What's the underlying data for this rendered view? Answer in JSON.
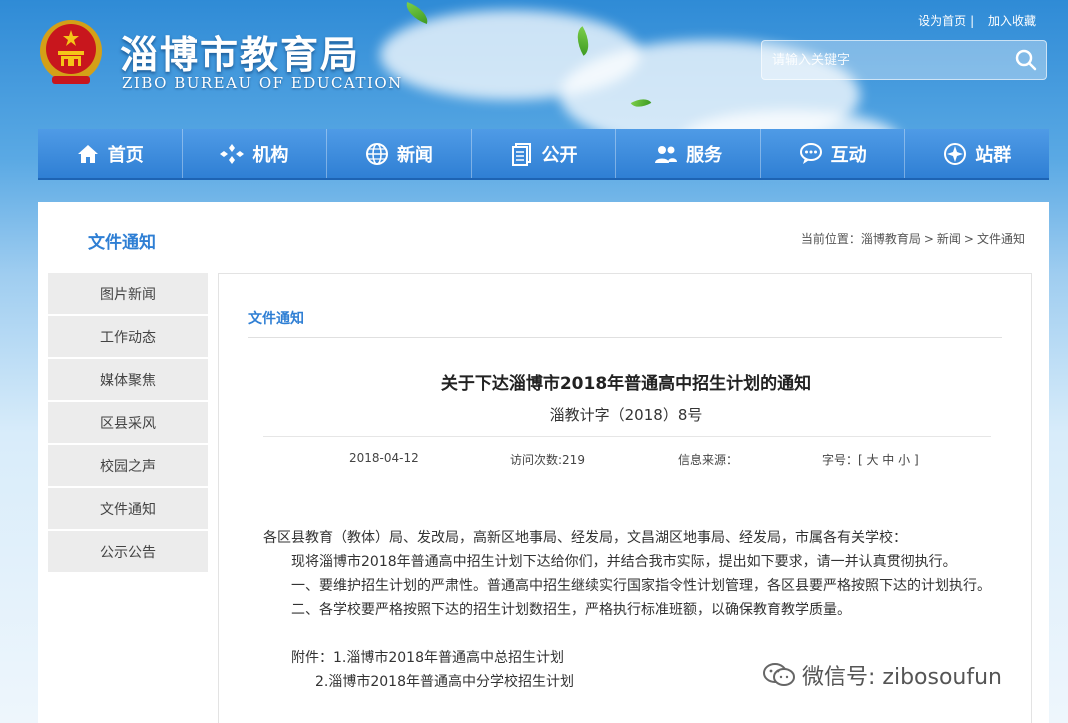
{
  "header": {
    "title": "淄博市教育局",
    "subtitle": "ZIBO BUREAU OF EDUCATION",
    "top_links": [
      "设为首页",
      "加入收藏"
    ],
    "top_sep": "|",
    "search_placeholder": "请输入关键字"
  },
  "nav": [
    {
      "label": "首页",
      "icon": "home-icon"
    },
    {
      "label": "机构",
      "icon": "org-icon"
    },
    {
      "label": "新闻",
      "icon": "globe-icon"
    },
    {
      "label": "公开",
      "icon": "document-icon"
    },
    {
      "label": "服务",
      "icon": "people-icon"
    },
    {
      "label": "互动",
      "icon": "chat-icon"
    },
    {
      "label": "站群",
      "icon": "sitegroup-icon"
    }
  ],
  "sidebar": {
    "title": "文件通知",
    "items": [
      "图片新闻",
      "工作动态",
      "媒体聚焦",
      "区县采风",
      "校园之声",
      "文件通知",
      "公示公告"
    ]
  },
  "breadcrumb": {
    "prefix": "当前位置：",
    "items": [
      "淄博教育局",
      "新闻",
      "文件通知"
    ],
    "arrow": ">"
  },
  "article": {
    "category": "文件通知",
    "title": "关于下达淄博市2018年普通高中招生计划的通知",
    "doc_number": "淄教计字（2018）8号",
    "date": "2018-04-12",
    "visits": "访问次数:219",
    "source": "信息来源：",
    "font_size": "字号：[ 大 中 小 ]",
    "paragraphs": [
      "各区县教育（教体）局、发改局，高新区地事局、经发局，文昌湖区地事局、经发局，市属各有关学校：",
      "现将淄博市2018年普通高中招生计划下达给你们，并结合我市实际，提出如下要求，请一并认真贯彻执行。",
      "一、要维护招生计划的严肃性。普通高中招生继续实行国家指令性计划管理，各区县要严格按照下达的计划执行。",
      "二、各学校要严格按照下达的招生计划数招生，严格执行标准班额，以确保教育教学质量。",
      "附件：1.淄博市2018年普通高中总招生计划",
      "2.淄博市2018年普通高中分学校招生计划"
    ]
  },
  "watermark": "微信号: zibosoufun",
  "colors": {
    "accent": "#2f7fd4",
    "nav_bg": "#3a88da"
  }
}
